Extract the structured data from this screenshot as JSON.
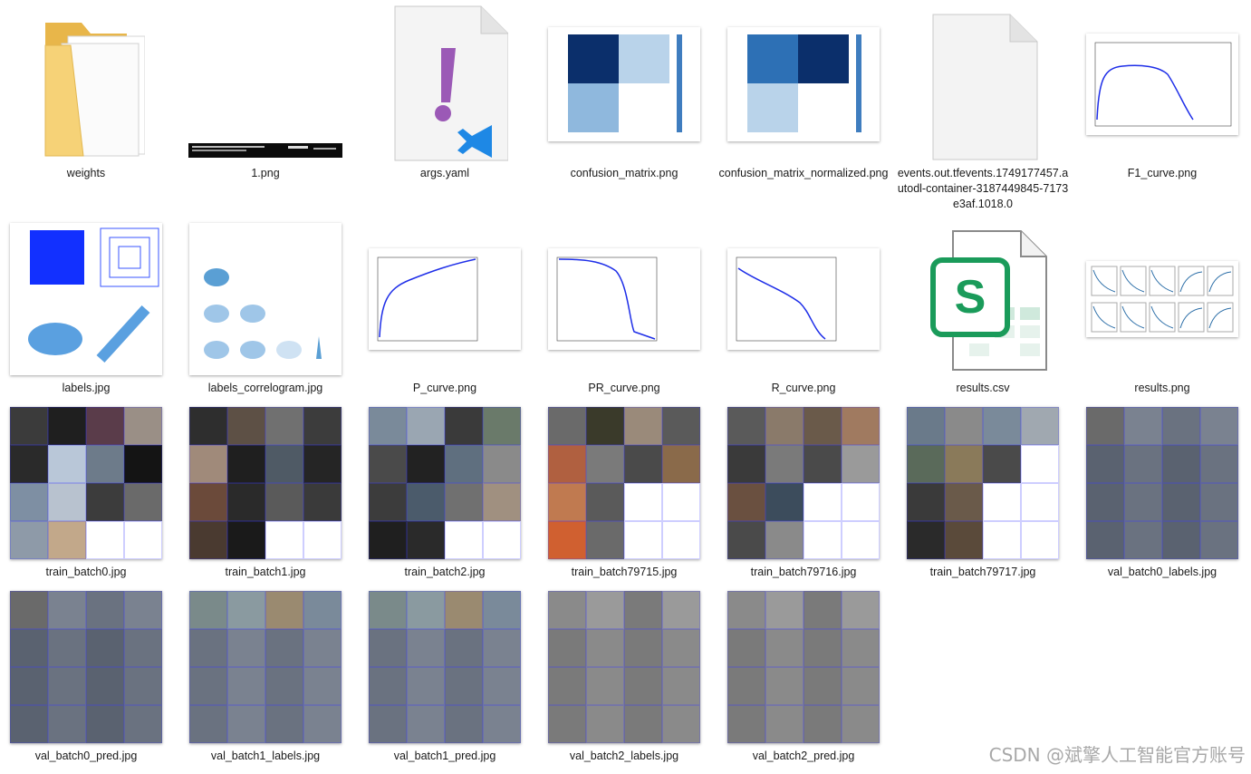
{
  "files": [
    {
      "name": "weights",
      "type": "folder"
    },
    {
      "name": "1.png",
      "type": "terminal-image"
    },
    {
      "name": "args.yaml",
      "type": "yaml"
    },
    {
      "name": "confusion_matrix.png",
      "type": "heatmap"
    },
    {
      "name": "confusion_matrix_normalized.png",
      "type": "heatmap"
    },
    {
      "name": "events.out.tfevents.1749177457.autodl-container-3187449845-7173e3af.1018.0",
      "type": "blank-doc"
    },
    {
      "name": "F1_curve.png",
      "type": "curve"
    },
    {
      "name": "labels.jpg",
      "type": "labels"
    },
    {
      "name": "labels_correlogram.jpg",
      "type": "correlogram"
    },
    {
      "name": "P_curve.png",
      "type": "curve"
    },
    {
      "name": "PR_curve.png",
      "type": "curve"
    },
    {
      "name": "R_curve.png",
      "type": "curve"
    },
    {
      "name": "results.csv",
      "type": "csv"
    },
    {
      "name": "results.png",
      "type": "results"
    },
    {
      "name": "train_batch0.jpg",
      "type": "mosaic"
    },
    {
      "name": "train_batch1.jpg",
      "type": "mosaic"
    },
    {
      "name": "train_batch2.jpg",
      "type": "mosaic"
    },
    {
      "name": "train_batch79715.jpg",
      "type": "mosaic"
    },
    {
      "name": "train_batch79716.jpg",
      "type": "mosaic"
    },
    {
      "name": "train_batch79717.jpg",
      "type": "mosaic"
    },
    {
      "name": "val_batch0_labels.jpg",
      "type": "mosaic"
    },
    {
      "name": "val_batch0_pred.jpg",
      "type": "mosaic"
    },
    {
      "name": "val_batch1_labels.jpg",
      "type": "mosaic"
    },
    {
      "name": "val_batch1_pred.jpg",
      "type": "mosaic"
    },
    {
      "name": "val_batch2_labels.jpg",
      "type": "mosaic"
    },
    {
      "name": "val_batch2_pred.jpg",
      "type": "mosaic"
    }
  ],
  "watermark": "CSDN @斌擎人工智能官方账号",
  "colors": {
    "folder": "#f4c55a",
    "heatmap_dark": "#0b2f6b",
    "heatmap_light": "#b9d3ea",
    "curve_line": "#1e2ee8",
    "csv_green": "#1a9b5a",
    "yaml_purple": "#9b59b6",
    "vscode_blue": "#1e88e5"
  }
}
